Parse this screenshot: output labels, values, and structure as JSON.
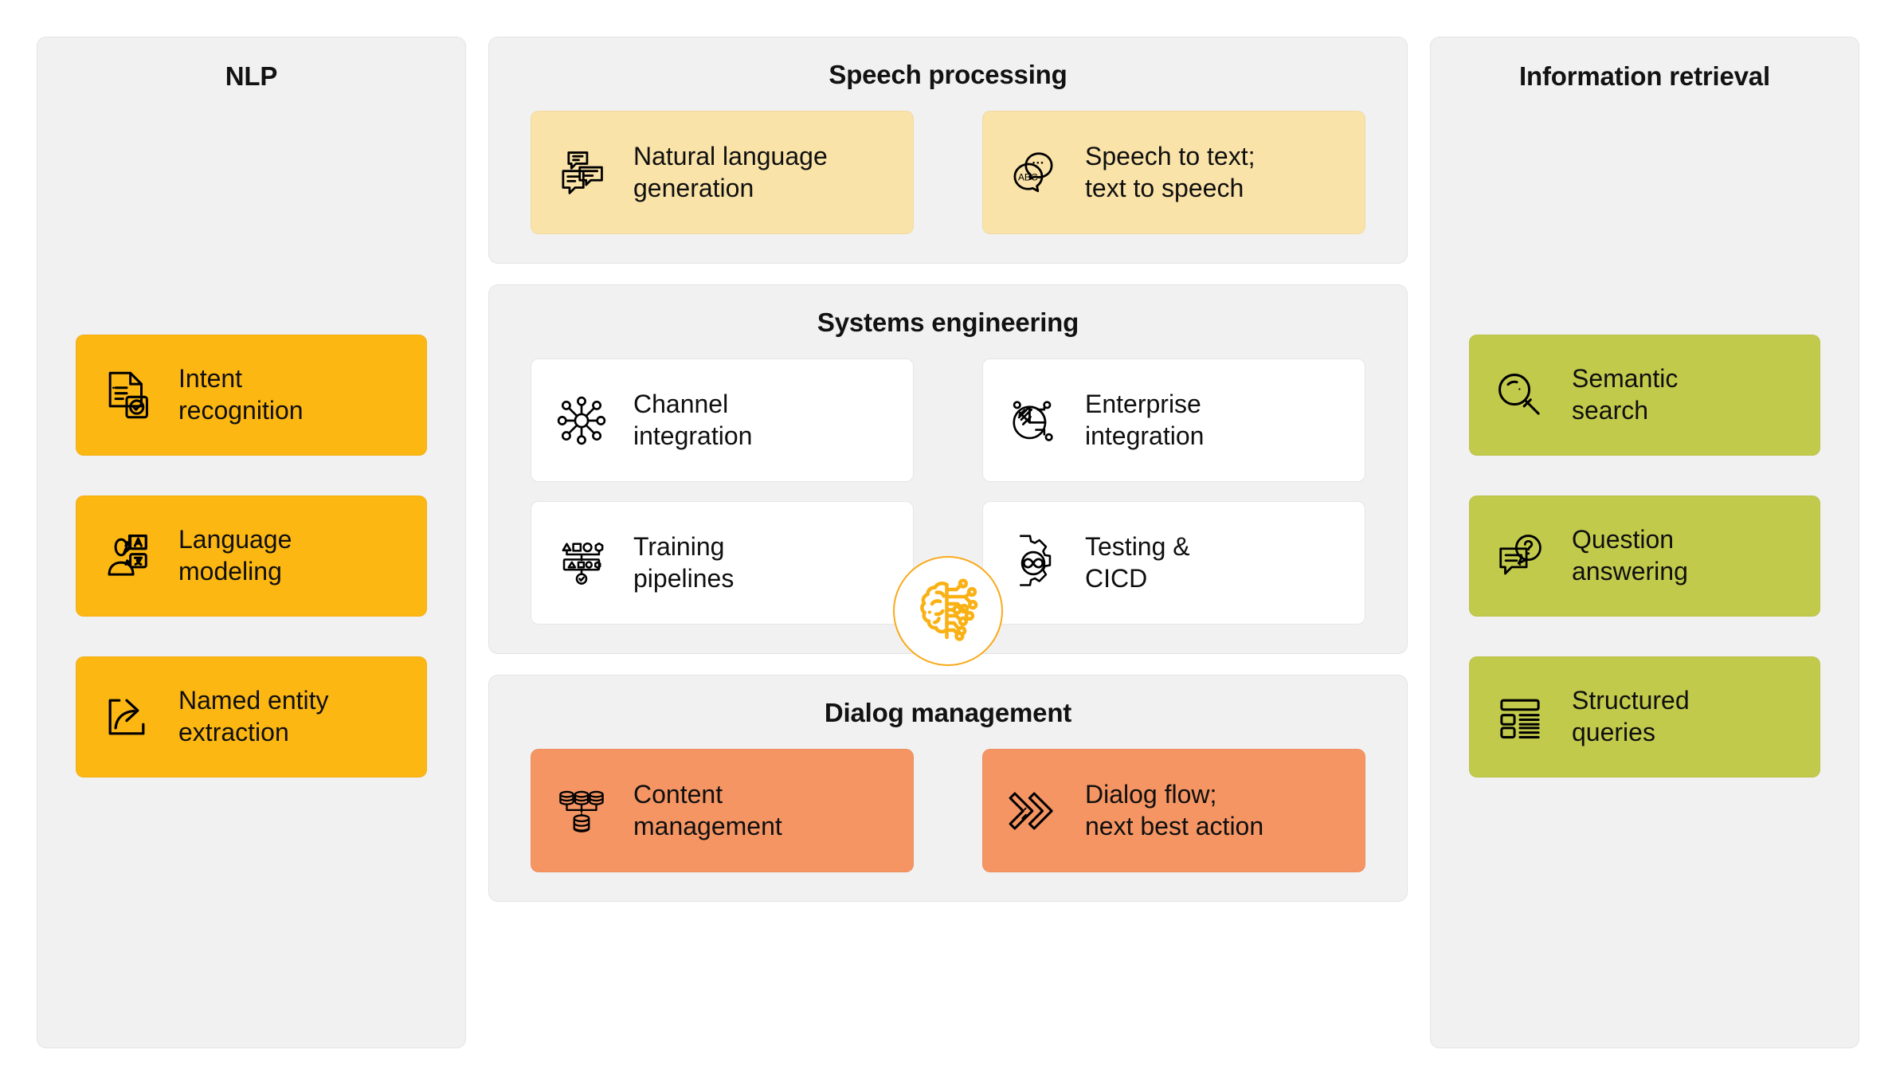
{
  "columns": {
    "left": {
      "title": "NLP",
      "cards": [
        {
          "label": "Intent\nrecognition",
          "icon": "document-check-icon",
          "color": "#fcb713"
        },
        {
          "label": "Language\nmodeling",
          "icon": "person-translate-icon",
          "color": "#fcb713"
        },
        {
          "label": "Named entity\nextraction",
          "icon": "export-arrow-icon",
          "color": "#fcb713"
        }
      ]
    },
    "right": {
      "title": "Information retrieval",
      "cards": [
        {
          "label": "Semantic\nsearch",
          "icon": "magnifier-icon",
          "color": "#c2ca4c"
        },
        {
          "label": "Question\nanswering",
          "icon": "chat-question-icon",
          "color": "#c2ca4c"
        },
        {
          "label": "Structured\nqueries",
          "icon": "table-list-icon",
          "color": "#c2ca4c"
        }
      ]
    }
  },
  "middle": {
    "speech": {
      "title": "Speech processing",
      "cards": [
        {
          "label": "Natural language\ngeneration",
          "icon": "chat-bubbles-icon",
          "color": "#fae3a8"
        },
        {
          "label": "Speech to text;\ntext to speech",
          "icon": "speech-abc-icon",
          "color": "#fae3a8"
        }
      ]
    },
    "systems": {
      "title": "Systems engineering",
      "cards": [
        {
          "label": "Channel\nintegration",
          "icon": "hub-network-icon",
          "color": "#ffffff"
        },
        {
          "label": "Enterprise\nintegration",
          "icon": "pie-nodes-icon",
          "color": "#ffffff"
        },
        {
          "label": "Training\npipelines",
          "icon": "shape-pipeline-icon",
          "color": "#ffffff"
        },
        {
          "label": "Testing &\nCICD",
          "icon": "gear-infinity-icon",
          "color": "#ffffff"
        }
      ]
    },
    "dialog": {
      "title": "Dialog management",
      "cards": [
        {
          "label": "Content\nmanagement",
          "icon": "database-stack-icon",
          "color": "#f59563"
        },
        {
          "label": "Dialog flow;\nnext best action",
          "icon": "double-chevron-icon",
          "color": "#f59563"
        }
      ]
    },
    "center_badge": {
      "icon": "ai-brain-circuit-icon",
      "color": "#f9a919"
    }
  }
}
